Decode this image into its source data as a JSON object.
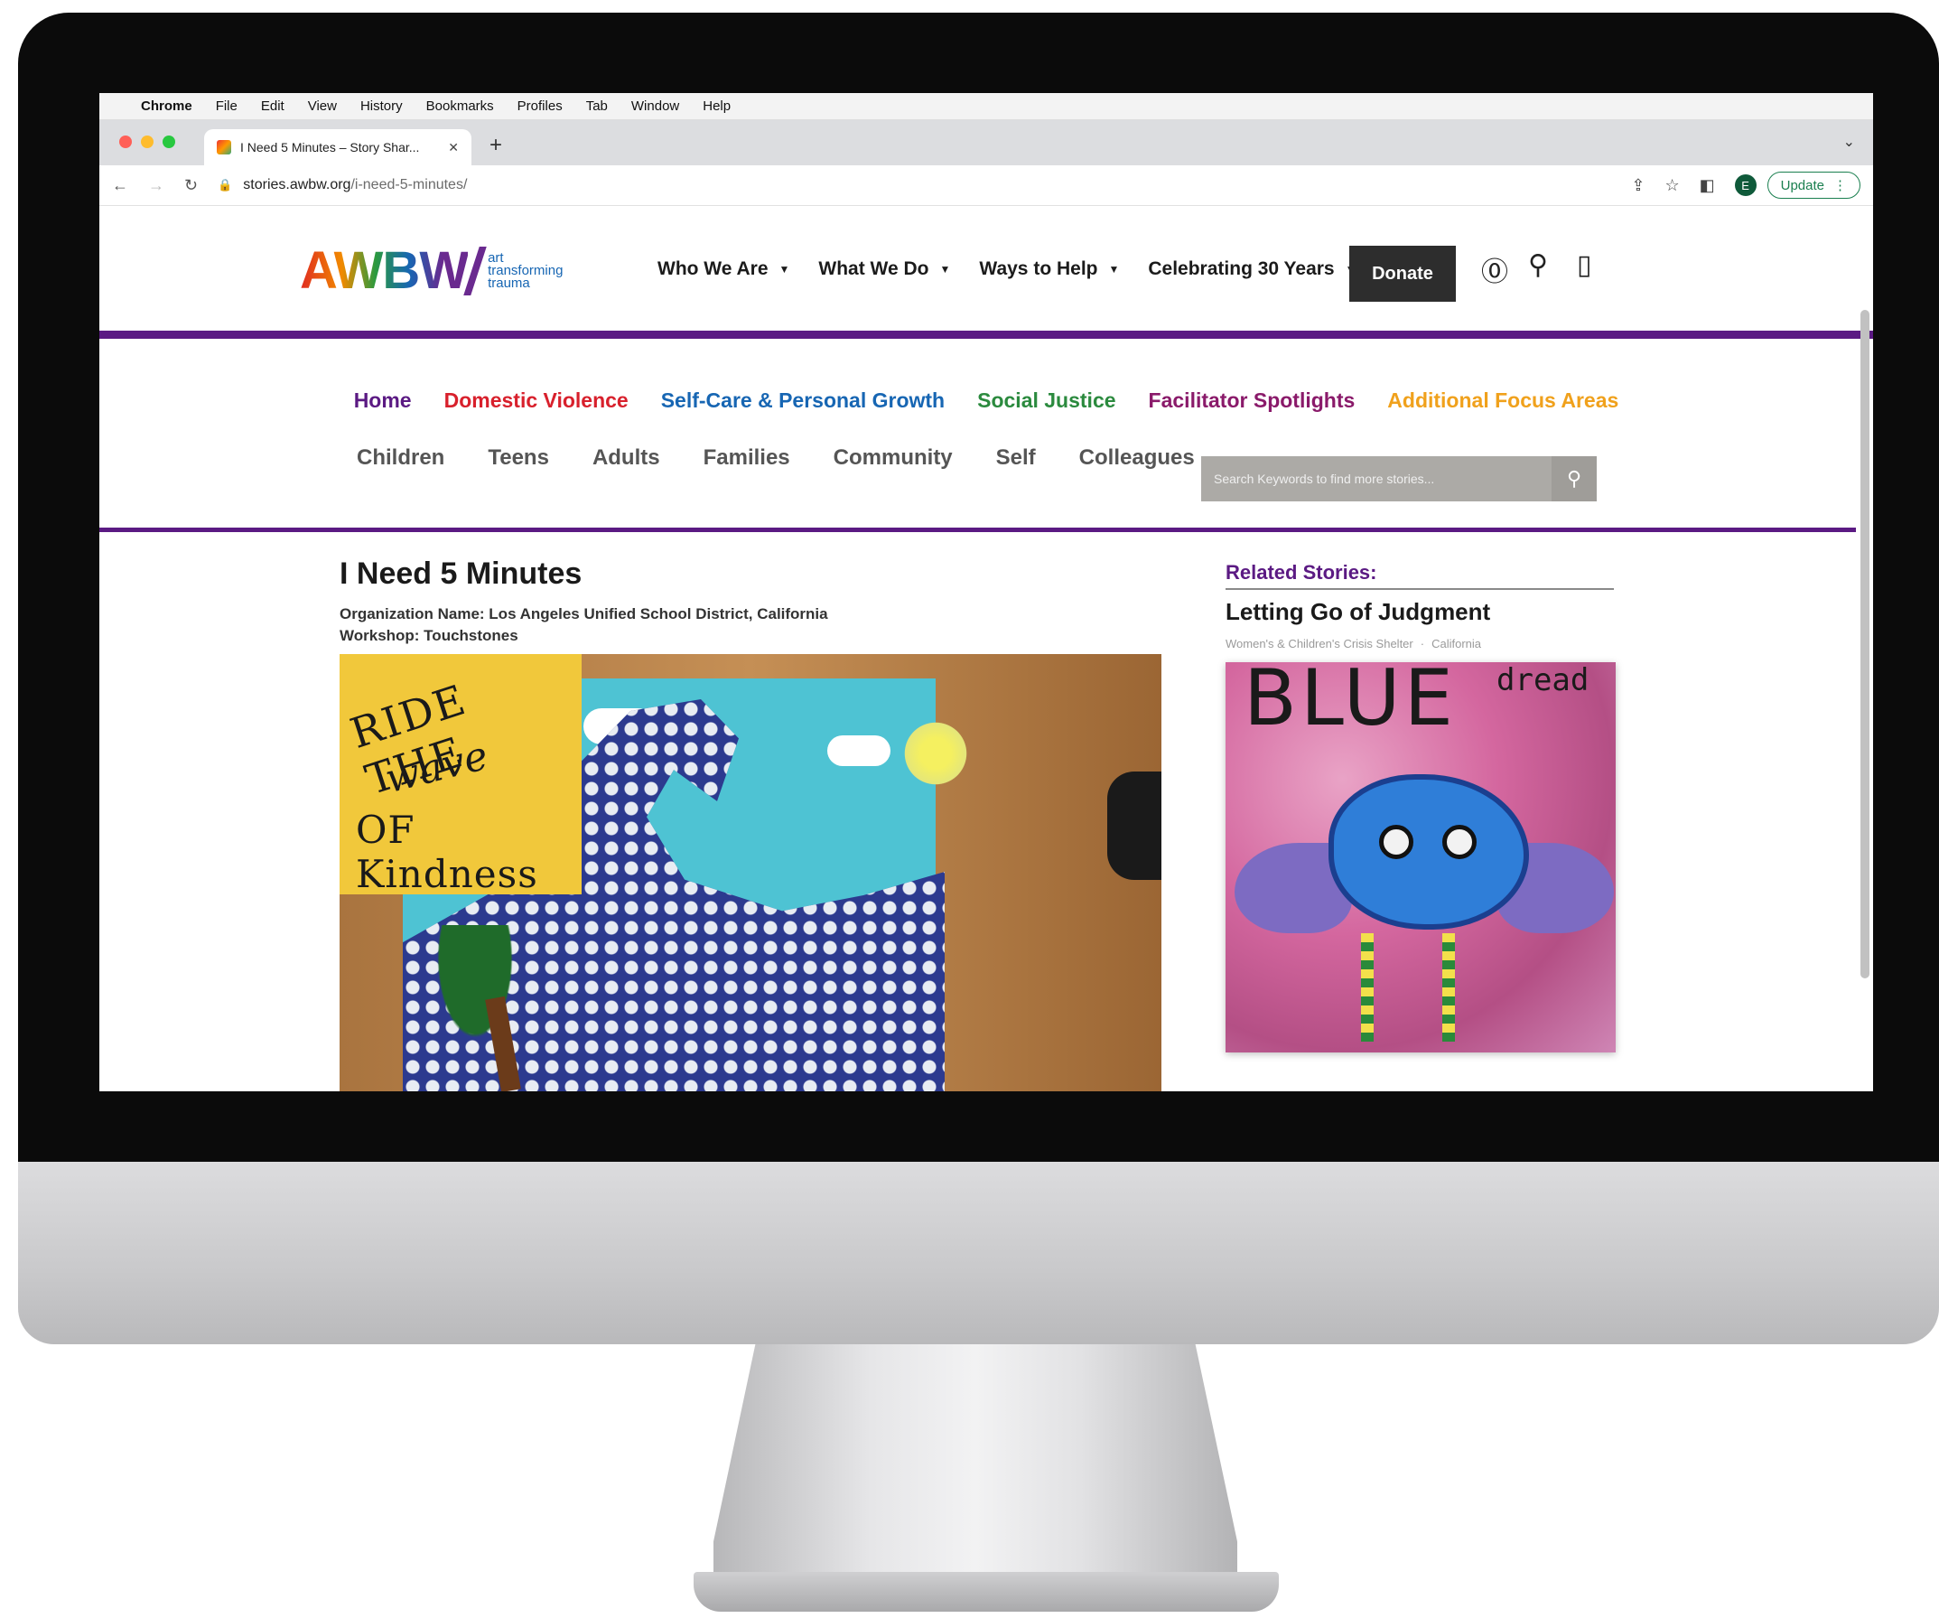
{
  "mac_menubar": {
    "items": [
      "Chrome",
      "File",
      "Edit",
      "View",
      "History",
      "Bookmarks",
      "Profiles",
      "Tab",
      "Window",
      "Help"
    ]
  },
  "browser": {
    "tab_title": "I Need 5 Minutes – Story Shar...",
    "url_host": "stories.awbw.org",
    "url_path": "/i-need-5-minutes/",
    "profile_initial": "E",
    "update_label": "Update"
  },
  "site": {
    "logo": {
      "word": "AWBW",
      "tagline_1": "art",
      "tagline_2": "transforming",
      "tagline_3": "trauma"
    },
    "main_nav": [
      "Who We Are",
      "What We Do",
      "Ways to Help",
      "Celebrating 30 Years"
    ],
    "donate_label": "Donate",
    "category_nav": [
      {
        "label": "Home",
        "color": "#5b1a83"
      },
      {
        "label": "Domestic Violence",
        "color": "#d8202c"
      },
      {
        "label": "Self-Care & Personal Growth",
        "color": "#1766b3"
      },
      {
        "label": "Social Justice",
        "color": "#2b8a3e"
      },
      {
        "label": "Facilitator Spotlights",
        "color": "#8a1a6a"
      },
      {
        "label": "Additional Focus Areas",
        "color": "#f0a11c"
      }
    ],
    "audience_nav": [
      "Children",
      "Teens",
      "Adults",
      "Families",
      "Community",
      "Self",
      "Colleagues"
    ],
    "search_placeholder": "Search Keywords to find more stories..."
  },
  "story": {
    "title": "I Need 5 Minutes",
    "organization": "Organization Name: Los Angeles Unified School District, California",
    "workshop": "Workshop: Touchstones",
    "art_text": {
      "line1": "RIDE THE",
      "line2": "wave",
      "line3": "OF Kindness"
    }
  },
  "related": {
    "heading": "Related Stories:",
    "title": "Letting Go of Judgment",
    "org": "Women's & Children's Crisis Shelter",
    "location": "California",
    "art_text": {
      "word": "BLUE",
      "corner": "dread"
    }
  },
  "icons": {
    "apple": "apple-icon",
    "search": "search-icon",
    "accessibility": "accessibility-icon",
    "exit": "exit-icon",
    "share": "share-icon",
    "star": "bookmark-star-icon",
    "sidepanel": "side-panel-icon"
  }
}
